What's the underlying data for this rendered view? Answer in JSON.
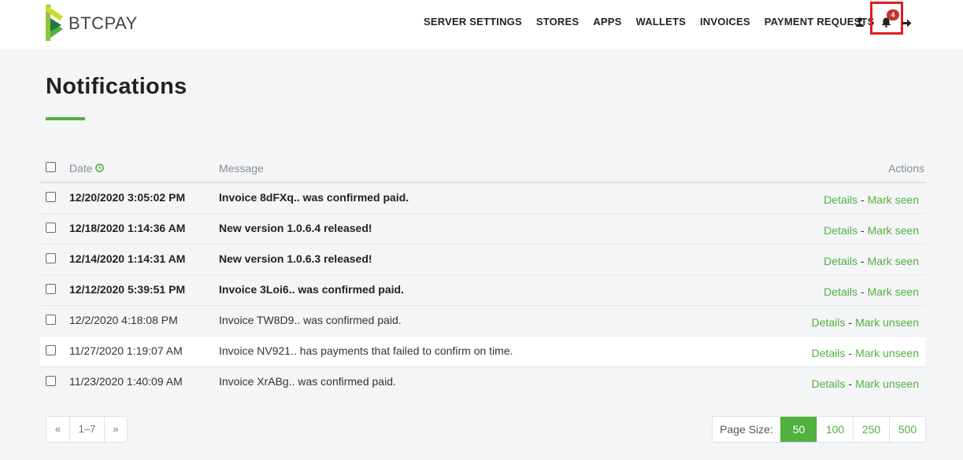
{
  "brand": {
    "name": "BTCPAY"
  },
  "nav": {
    "items": [
      {
        "label": "SERVER SETTINGS"
      },
      {
        "label": "STORES"
      },
      {
        "label": "APPS"
      },
      {
        "label": "WALLETS"
      },
      {
        "label": "INVOICES"
      },
      {
        "label": "PAYMENT REQUESTS"
      }
    ],
    "notification_count": "4",
    "icons": [
      "user-icon",
      "bell-icon",
      "logout-icon"
    ]
  },
  "page": {
    "title": "Notifications"
  },
  "table": {
    "headers": {
      "date": "Date",
      "message": "Message",
      "actions": "Actions"
    },
    "rows": [
      {
        "date": "12/20/2020 3:05:02 PM",
        "message": "Invoice 8dFXq.. was confirmed paid.",
        "details": "Details",
        "toggle": "Mark seen",
        "unread": true
      },
      {
        "date": "12/18/2020 1:14:36 AM",
        "message": "New version 1.0.6.4 released!",
        "details": "Details",
        "toggle": "Mark seen",
        "unread": true
      },
      {
        "date": "12/14/2020 1:14:31 AM",
        "message": "New version 1.0.6.3 released!",
        "details": "Details",
        "toggle": "Mark seen",
        "unread": true
      },
      {
        "date": "12/12/2020 5:39:51 PM",
        "message": "Invoice 3Loi6.. was confirmed paid.",
        "details": "Details",
        "toggle": "Mark seen",
        "unread": true
      },
      {
        "date": "12/2/2020 4:18:08 PM",
        "message": "Invoice TW8D9.. was confirmed paid.",
        "details": "Details",
        "toggle": "Mark unseen",
        "unread": false
      },
      {
        "date": "11/27/2020 1:19:07 AM",
        "message": "Invoice NV921.. has payments that failed to confirm on time.",
        "details": "Details",
        "toggle": "Mark unseen",
        "unread": false
      },
      {
        "date": "11/23/2020 1:40:09 AM",
        "message": "Invoice XrABg.. was confirmed paid.",
        "details": "Details",
        "toggle": "Mark unseen",
        "unread": false
      }
    ],
    "separator": "-"
  },
  "pagination": {
    "prev": "«",
    "range": "1–7",
    "next": "»"
  },
  "page_size": {
    "label": "Page Size:",
    "options": [
      "50",
      "100",
      "250",
      "500"
    ],
    "selected": "50"
  },
  "colors": {
    "accent": "#51b13e",
    "highlight_box": "#e31b23",
    "badge": "#c9302c"
  }
}
